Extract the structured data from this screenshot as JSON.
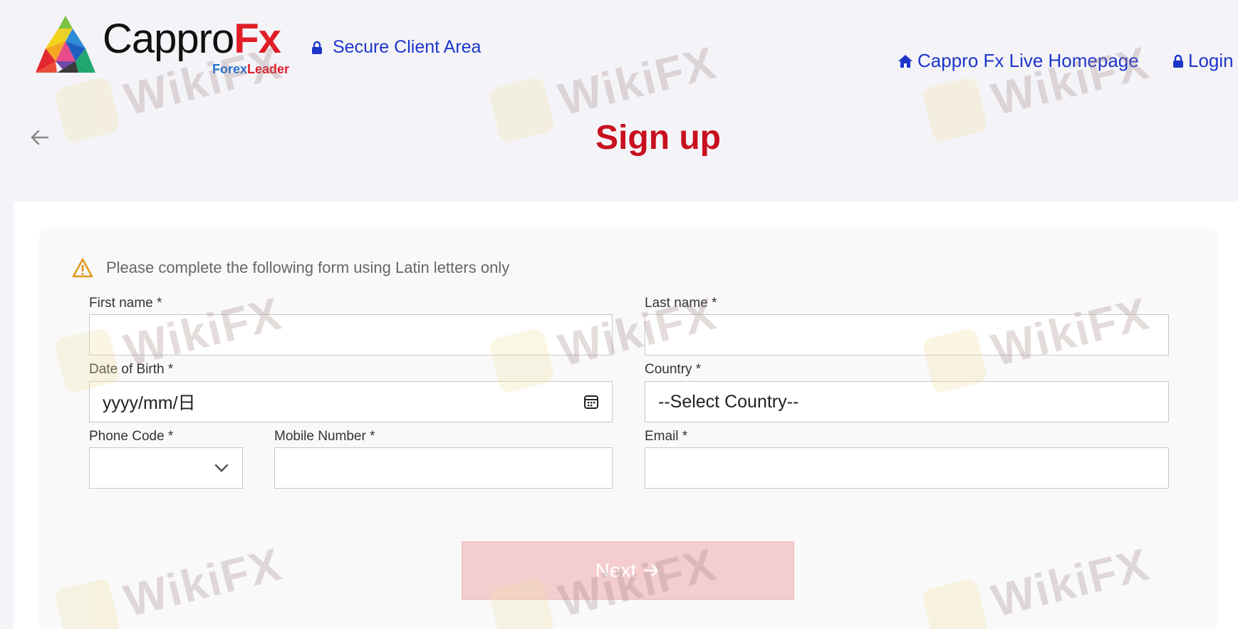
{
  "header": {
    "logo_main": "Cappro",
    "logo_fx": "Fx",
    "logo_forex": "Forex",
    "logo_leader": "Leader",
    "secure_label": "Secure Client Area",
    "home_link": "Cappro Fx Live Homepage",
    "login_link": "Login"
  },
  "page": {
    "title": "Sign up"
  },
  "form": {
    "notice": "Please complete the following form using Latin letters only",
    "first_name_label": "First name *",
    "first_name_value": "",
    "last_name_label": "Last name *",
    "last_name_value": "",
    "dob_label": "Date of Birth *",
    "dob_placeholder": "yyyy/mm/日",
    "country_label": "Country *",
    "country_value": "--Select Country--",
    "phone_code_label": "Phone Code *",
    "phone_code_value": "",
    "mobile_label": "Mobile Number *",
    "mobile_value": "",
    "email_label": "Email *",
    "email_value": "",
    "next_label": "Next"
  },
  "watermark": {
    "text": "WikiFX"
  },
  "colors": {
    "brand_red": "#c8101f",
    "link_blue": "#1d35c9",
    "warning": "#e09a1e",
    "button_disabled": "#f4cdcf"
  },
  "icons": {
    "secure": "lock-icon",
    "home": "home-icon",
    "login": "lock-icon",
    "back": "arrow-left-icon",
    "notice": "warning-icon",
    "dob": "calendar-icon",
    "phone_code": "chevron-down-icon",
    "next": "arrow-right-icon"
  }
}
